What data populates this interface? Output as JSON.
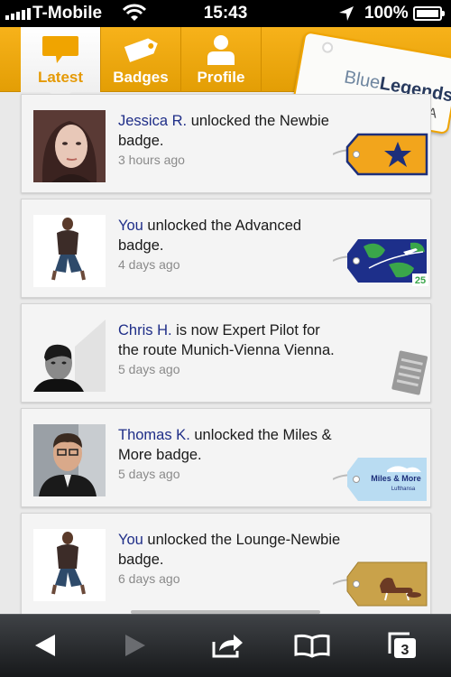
{
  "status_bar": {
    "carrier": "T-Mobile",
    "time": "15:43",
    "battery": "100%"
  },
  "tabs": [
    {
      "label": "Latest",
      "icon": "speech-bubble-icon",
      "active": true
    },
    {
      "label": "Badges",
      "icon": "tag-icon",
      "active": false
    },
    {
      "label": "Profile",
      "icon": "person-icon",
      "active": false
    }
  ],
  "brand": {
    "name_light": "Blue",
    "name_bold": "Legends",
    "tag": "BETA"
  },
  "feed": [
    {
      "who": "Jessica R.",
      "text": " unlocked the Newbie badge.",
      "time": "3 hours ago",
      "badge": "star-badge-icon"
    },
    {
      "who": "You",
      "text": " unlocked the Advanced badge.",
      "time": "4 days ago",
      "badge": "globe-25-badge-icon",
      "badge_number": "25"
    },
    {
      "who": "Chris H.",
      "text": " is now Expert Pilot for the route Munich-Vienna Vienna.",
      "time": "5 days ago",
      "badge": "document-icon"
    },
    {
      "who": "Thomas K.",
      "text": " unlocked the Miles & More badge.",
      "time": "5 days ago",
      "badge": "miles-more-badge-icon",
      "badge_line1": "Miles & More",
      "badge_line2": "Lufthansa"
    },
    {
      "who": "You",
      "text": " unlocked the Lounge-Newbie badge.",
      "time": "6 days ago",
      "badge": "lounge-chair-badge-icon"
    }
  ],
  "toolbar": {
    "tabs_count": "3",
    "buttons": [
      "back-icon",
      "forward-icon",
      "share-icon",
      "bookmarks-icon",
      "tabs-icon"
    ]
  },
  "colors": {
    "accent": "#f0a400",
    "link": "#1f2e88",
    "badge_navy": "#1d2f7a"
  }
}
